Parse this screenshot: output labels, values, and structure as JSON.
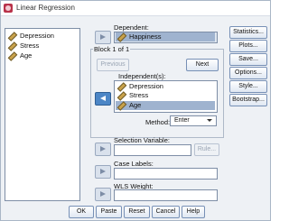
{
  "window": {
    "title": "Linear Regression"
  },
  "source_variables": [
    {
      "label": "Depression"
    },
    {
      "label": "Stress"
    },
    {
      "label": "Age"
    }
  ],
  "dependent": {
    "label": "Dependent:",
    "value": "Happiness"
  },
  "block": {
    "label": "Block 1 of 1",
    "previous": "Previous",
    "next": "Next"
  },
  "independents": {
    "label": "Independent(s):",
    "items": [
      {
        "label": "Depression"
      },
      {
        "label": "Stress"
      },
      {
        "label": "Age"
      }
    ]
  },
  "method": {
    "label": "Method:",
    "value": "Enter"
  },
  "selection": {
    "label": "Selection Variable:",
    "rule_button": "Rule..."
  },
  "case_labels": {
    "label": "Case Labels:"
  },
  "wls": {
    "label": "WLS Weight:"
  },
  "side_buttons": {
    "statistics": "Statistics...",
    "plots": "Plots...",
    "save": "Save...",
    "options": "Options...",
    "style": "Style...",
    "bootstrap": "Bootstrap..."
  },
  "bottom_buttons": {
    "ok": "OK",
    "paste": "Paste",
    "reset": "Reset",
    "cancel": "Cancel",
    "help": "Help"
  }
}
